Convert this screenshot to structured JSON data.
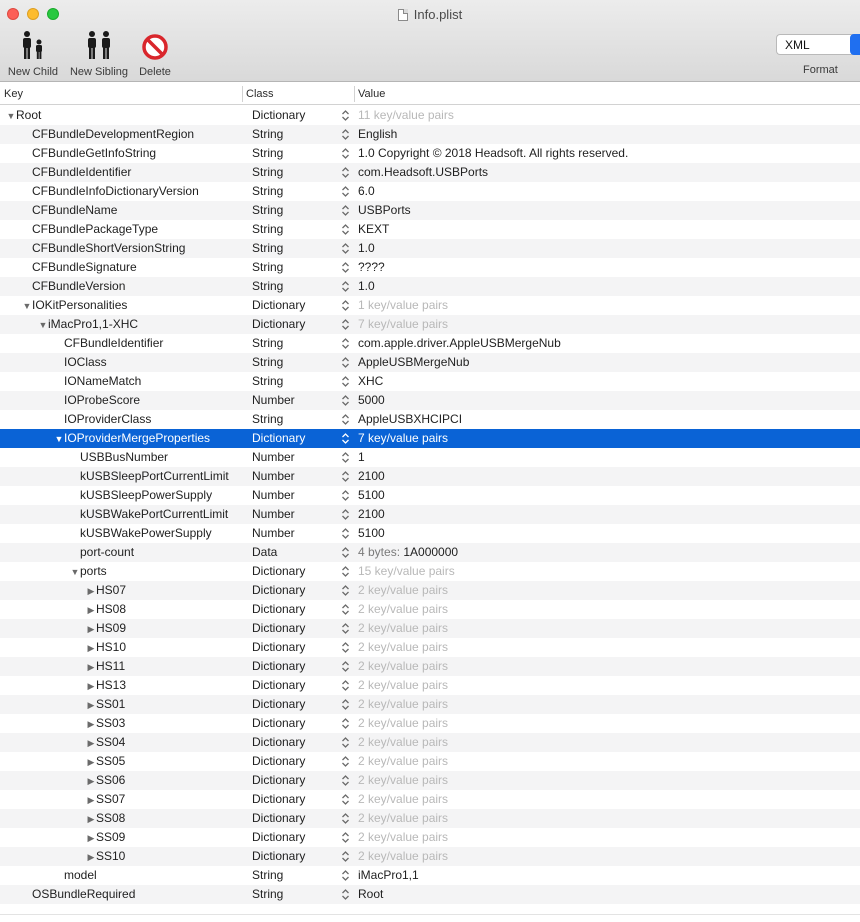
{
  "window": {
    "title": "Info.plist"
  },
  "toolbar": {
    "new_child": "New Child",
    "new_sibling": "New Sibling",
    "delete": "Delete",
    "format_value": "XML",
    "format_label": "Format"
  },
  "columns": {
    "key": "Key",
    "class": "Class",
    "value": "Value"
  },
  "colors": {
    "selection": "#0a63d6",
    "accent": "#1f6ff0"
  },
  "rows": [
    {
      "key": "Root",
      "class": "Dictionary",
      "value": "11 key/value pairs",
      "level": 0,
      "disclosure": "open",
      "muted": true
    },
    {
      "key": "CFBundleDevelopmentRegion",
      "class": "String",
      "value": "English",
      "level": 1
    },
    {
      "key": "CFBundleGetInfoString",
      "class": "String",
      "value": "1.0 Copyright © 2018 Headsoft. All rights reserved.",
      "level": 1
    },
    {
      "key": "CFBundleIdentifier",
      "class": "String",
      "value": "com.Headsoft.USBPorts",
      "level": 1
    },
    {
      "key": "CFBundleInfoDictionaryVersion",
      "class": "String",
      "value": "6.0",
      "level": 1
    },
    {
      "key": "CFBundleName",
      "class": "String",
      "value": "USBPorts",
      "level": 1
    },
    {
      "key": "CFBundlePackageType",
      "class": "String",
      "value": "KEXT",
      "level": 1
    },
    {
      "key": "CFBundleShortVersionString",
      "class": "String",
      "value": "1.0",
      "level": 1
    },
    {
      "key": "CFBundleSignature",
      "class": "String",
      "value": "????",
      "level": 1
    },
    {
      "key": "CFBundleVersion",
      "class": "String",
      "value": "1.0",
      "level": 1
    },
    {
      "key": "IOKitPersonalities",
      "class": "Dictionary",
      "value": "1 key/value pairs",
      "level": 1,
      "disclosure": "open",
      "muted": true
    },
    {
      "key": "iMacPro1,1-XHC",
      "class": "Dictionary",
      "value": "7 key/value pairs",
      "level": 2,
      "disclosure": "open",
      "muted": true
    },
    {
      "key": "CFBundleIdentifier",
      "class": "String",
      "value": "com.apple.driver.AppleUSBMergeNub",
      "level": 3
    },
    {
      "key": "IOClass",
      "class": "String",
      "value": "AppleUSBMergeNub",
      "level": 3
    },
    {
      "key": "IONameMatch",
      "class": "String",
      "value": "XHC",
      "level": 3
    },
    {
      "key": "IOProbeScore",
      "class": "Number",
      "value": "5000",
      "level": 3
    },
    {
      "key": "IOProviderClass",
      "class": "String",
      "value": "AppleUSBXHCIPCI",
      "level": 3
    },
    {
      "key": "IOProviderMergeProperties",
      "class": "Dictionary",
      "value": "7 key/value pairs",
      "level": 3,
      "disclosure": "open",
      "muted": true,
      "selected": true
    },
    {
      "key": "USBBusNumber",
      "class": "Number",
      "value": "1",
      "level": 4
    },
    {
      "key": "kUSBSleepPortCurrentLimit",
      "class": "Number",
      "value": "2100",
      "level": 4
    },
    {
      "key": "kUSBSleepPowerSupply",
      "class": "Number",
      "value": "5100",
      "level": 4
    },
    {
      "key": "kUSBWakePortCurrentLimit",
      "class": "Number",
      "value": "2100",
      "level": 4
    },
    {
      "key": "kUSBWakePowerSupply",
      "class": "Number",
      "value": "5100",
      "level": 4
    },
    {
      "key": "port-count",
      "class": "Data",
      "value": "1A000000",
      "value_prefix": "4 bytes: ",
      "level": 4
    },
    {
      "key": "ports",
      "class": "Dictionary",
      "value": "15 key/value pairs",
      "level": 4,
      "disclosure": "open",
      "muted": true
    },
    {
      "key": "HS07",
      "class": "Dictionary",
      "value": "2 key/value pairs",
      "level": 5,
      "disclosure": "closed",
      "muted": true
    },
    {
      "key": "HS08",
      "class": "Dictionary",
      "value": "2 key/value pairs",
      "level": 5,
      "disclosure": "closed",
      "muted": true
    },
    {
      "key": "HS09",
      "class": "Dictionary",
      "value": "2 key/value pairs",
      "level": 5,
      "disclosure": "closed",
      "muted": true
    },
    {
      "key": "HS10",
      "class": "Dictionary",
      "value": "2 key/value pairs",
      "level": 5,
      "disclosure": "closed",
      "muted": true
    },
    {
      "key": "HS11",
      "class": "Dictionary",
      "value": "2 key/value pairs",
      "level": 5,
      "disclosure": "closed",
      "muted": true
    },
    {
      "key": "HS13",
      "class": "Dictionary",
      "value": "2 key/value pairs",
      "level": 5,
      "disclosure": "closed",
      "muted": true
    },
    {
      "key": "SS01",
      "class": "Dictionary",
      "value": "2 key/value pairs",
      "level": 5,
      "disclosure": "closed",
      "muted": true
    },
    {
      "key": "SS03",
      "class": "Dictionary",
      "value": "2 key/value pairs",
      "level": 5,
      "disclosure": "closed",
      "muted": true
    },
    {
      "key": "SS04",
      "class": "Dictionary",
      "value": "2 key/value pairs",
      "level": 5,
      "disclosure": "closed",
      "muted": true
    },
    {
      "key": "SS05",
      "class": "Dictionary",
      "value": "2 key/value pairs",
      "level": 5,
      "disclosure": "closed",
      "muted": true
    },
    {
      "key": "SS06",
      "class": "Dictionary",
      "value": "2 key/value pairs",
      "level": 5,
      "disclosure": "closed",
      "muted": true
    },
    {
      "key": "SS07",
      "class": "Dictionary",
      "value": "2 key/value pairs",
      "level": 5,
      "disclosure": "closed",
      "muted": true
    },
    {
      "key": "SS08",
      "class": "Dictionary",
      "value": "2 key/value pairs",
      "level": 5,
      "disclosure": "closed",
      "muted": true
    },
    {
      "key": "SS09",
      "class": "Dictionary",
      "value": "2 key/value pairs",
      "level": 5,
      "disclosure": "closed",
      "muted": true
    },
    {
      "key": "SS10",
      "class": "Dictionary",
      "value": "2 key/value pairs",
      "level": 5,
      "disclosure": "closed",
      "muted": true
    },
    {
      "key": "model",
      "class": "String",
      "value": "iMacPro1,1",
      "level": 3
    },
    {
      "key": "OSBundleRequired",
      "class": "String",
      "value": "Root",
      "level": 1
    }
  ]
}
